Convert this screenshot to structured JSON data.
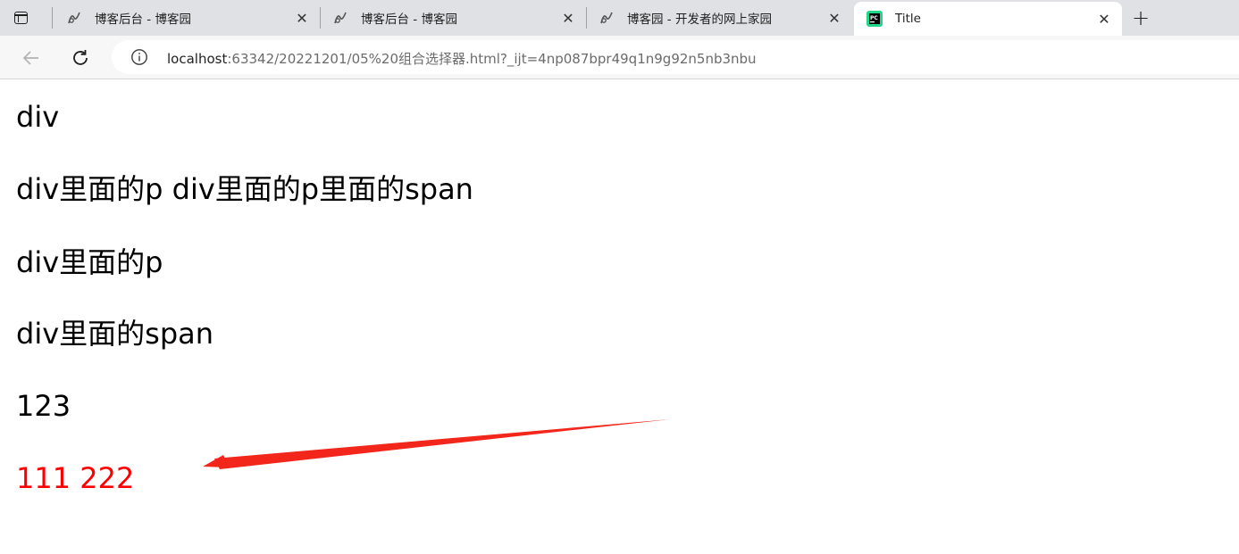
{
  "browser": {
    "tabs": [
      {
        "title": "博客后台 - 博客园",
        "icon": "cnblogs-icon",
        "close": "✕"
      },
      {
        "title": "博客后台 - 博客园",
        "icon": "cnblogs-icon",
        "close": "✕"
      },
      {
        "title": "博客园 - 开发者的网上家园",
        "icon": "cnblogs-icon",
        "close": "✕"
      },
      {
        "title": "Title",
        "icon": "pycharm-icon",
        "close": "✕",
        "active": true
      }
    ],
    "new_tab": "+",
    "address": {
      "host": "localhost",
      "path": ":63342/20221201/05%20组合选择器.html?_ijt=4np087bpr49q1n9g92n5nb3nbu"
    }
  },
  "content": {
    "lines": [
      "div",
      "div里面的p div里面的p里面的span",
      "div里面的p",
      "div里面的span",
      "123",
      "111 222"
    ],
    "highlight_color": "#ff0000",
    "annotation": "red-arrow"
  }
}
